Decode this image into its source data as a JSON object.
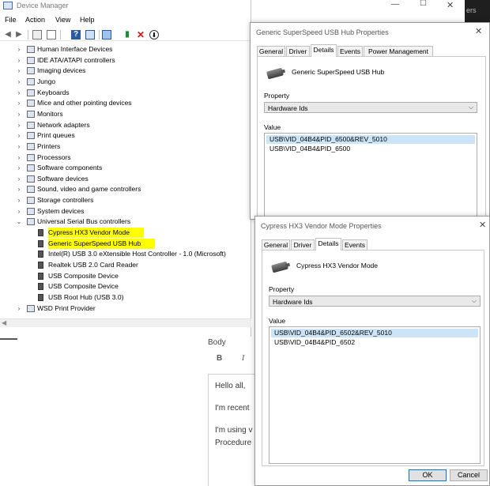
{
  "device_manager": {
    "title": "Device Manager",
    "menu": [
      "File",
      "Action",
      "View",
      "Help"
    ],
    "toolbar": [
      "back-icon",
      "forward-icon",
      "show-hide-icon",
      "properties-icon",
      "help-icon",
      "view-icon",
      "monitor-icon",
      "update-driver-icon",
      "uninstall-icon",
      "disable-icon"
    ],
    "window_controls": {
      "minimize": "—",
      "maximize": "☐",
      "close": "✕"
    },
    "tree": [
      {
        "label": "Human Interface Devices",
        "level": 0,
        "expanded": false
      },
      {
        "label": "IDE ATA/ATAPI controllers",
        "level": 0,
        "expanded": false
      },
      {
        "label": "Imaging devices",
        "level": 0,
        "expanded": false
      },
      {
        "label": "Jungo",
        "level": 0,
        "expanded": false
      },
      {
        "label": "Keyboards",
        "level": 0,
        "expanded": false
      },
      {
        "label": "Mice and other pointing devices",
        "level": 0,
        "expanded": false
      },
      {
        "label": "Monitors",
        "level": 0,
        "expanded": false
      },
      {
        "label": "Network adapters",
        "level": 0,
        "expanded": false
      },
      {
        "label": "Print queues",
        "level": 0,
        "expanded": false
      },
      {
        "label": "Printers",
        "level": 0,
        "expanded": false
      },
      {
        "label": "Processors",
        "level": 0,
        "expanded": false
      },
      {
        "label": "Software components",
        "level": 0,
        "expanded": false
      },
      {
        "label": "Software devices",
        "level": 0,
        "expanded": false
      },
      {
        "label": "Sound, video and game controllers",
        "level": 0,
        "expanded": false
      },
      {
        "label": "Storage controllers",
        "level": 0,
        "expanded": false
      },
      {
        "label": "System devices",
        "level": 0,
        "expanded": false
      },
      {
        "label": "Universal Serial Bus controllers",
        "level": 0,
        "expanded": true
      },
      {
        "label": "Cypress HX3 Vendor Mode",
        "level": 1,
        "highlight": true
      },
      {
        "label": "Generic SuperSpeed USB Hub",
        "level": 1,
        "highlight": true
      },
      {
        "label": "Intel(R) USB 3.0 eXtensible Host Controller - 1.0 (Microsoft)",
        "level": 1
      },
      {
        "label": "Realtek USB 2.0 Card Reader",
        "level": 1
      },
      {
        "label": "USB Composite Device",
        "level": 1
      },
      {
        "label": "USB Composite Device",
        "level": 1
      },
      {
        "label": "USB Root Hub (USB 3.0)",
        "level": 1
      },
      {
        "label": "WSD Print Provider",
        "level": 0,
        "expanded": false
      }
    ],
    "highlight_color": "#ffff00"
  },
  "edge_text": "ers",
  "web_page": {
    "body_label": "Body",
    "bold": "B",
    "italic": "I",
    "lines": [
      "Hello all,",
      "I'm recent",
      "I'm using v",
      "Procedure"
    ]
  },
  "hub_dialog": {
    "title": "Generic SuperSpeed USB Hub Properties",
    "tabs": [
      "General",
      "Driver",
      "Details",
      "Events",
      "Power Management"
    ],
    "active_tab": "Details",
    "device_name": "Generic SuperSpeed USB Hub",
    "property_label": "Property",
    "property_value": "Hardware Ids",
    "value_label": "Value",
    "values": [
      "USB\\VID_04B4&PID_6500&REV_5010",
      "USB\\VID_04B4&PID_6500"
    ]
  },
  "cypress_dialog": {
    "title": "Cypress HX3 Vendor Mode Properties",
    "tabs": [
      "General",
      "Driver",
      "Details",
      "Events"
    ],
    "active_tab": "Details",
    "device_name": "Cypress HX3 Vendor Mode",
    "property_label": "Property",
    "property_value": "Hardware Ids",
    "value_label": "Value",
    "values": [
      "USB\\VID_04B4&PID_6502&REV_5010",
      "USB\\VID_04B4&PID_6502"
    ],
    "ok": "OK",
    "cancel": "Cancel"
  }
}
